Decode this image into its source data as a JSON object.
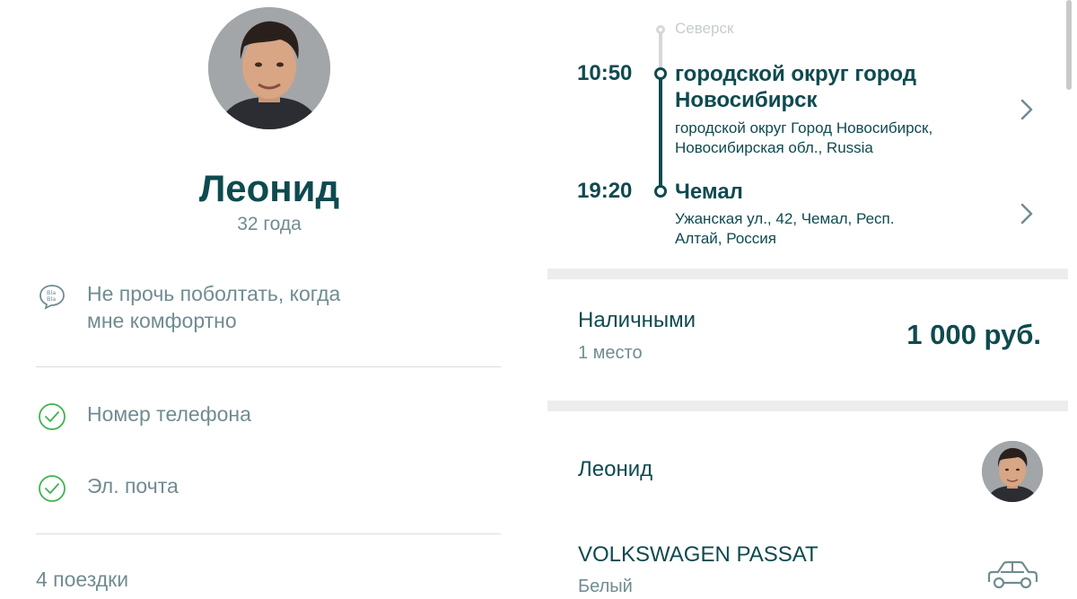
{
  "driver": {
    "name": "Леонид",
    "age": "32 года"
  },
  "preferences": [
    {
      "icon": "bla-bla-chat-icon",
      "label": "Не прочь поболтать, когда мне комфортно"
    }
  ],
  "verifications": [
    {
      "icon": "check-circle-icon",
      "label": "Номер телефона"
    },
    {
      "icon": "check-circle-icon",
      "label": "Эл. почта"
    }
  ],
  "trips": "4 поездки",
  "route": {
    "previous_stop": "Северск",
    "departure": {
      "time": "10:50",
      "title": "городской округ город Новосибирск",
      "address": "городской округ Город Новосибирск, Новосибирская обл., Russia"
    },
    "arrival": {
      "time": "19:20",
      "title": "Чемал",
      "address": "Ужанская ул., 42, Чемал, Респ. Алтай, Россия"
    }
  },
  "payment": {
    "method": "Наличными",
    "seats": "1 место",
    "price": "1 000 руб."
  },
  "car": {
    "driver_name": "Леонид",
    "model": "VOLKSWAGEN PASSAT",
    "color": "Белый",
    "icon": "car-icon"
  },
  "colors": {
    "primary": "#0e4a4f",
    "secondary_text": "#708c91",
    "success": "#3fb34f"
  }
}
